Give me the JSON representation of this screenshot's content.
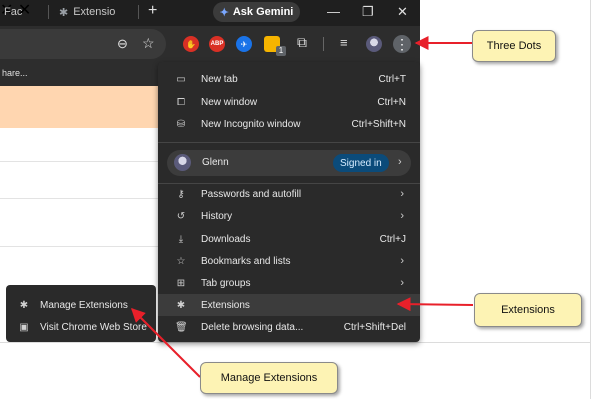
{
  "tabs": [
    {
      "title": "Fac",
      "close": "✕"
    },
    {
      "title": "Extensio",
      "close": "✕"
    }
  ],
  "new_tab": "+",
  "ask_gemini": "Ask Gemini",
  "window_controls": {
    "minimize": "—",
    "restore": "❐",
    "close": "✕"
  },
  "bookmark_bar_text": "hare...",
  "menu": {
    "items": [
      {
        "label": "New tab",
        "shortcut": "Ctrl+T",
        "icon": "new-tab-icon"
      },
      {
        "label": "New window",
        "shortcut": "Ctrl+N",
        "icon": "new-window-icon"
      },
      {
        "label": "New Incognito window",
        "shortcut": "Ctrl+Shift+N",
        "icon": "incognito-icon"
      }
    ],
    "profile": {
      "name": "Glenn",
      "status": "Signed in"
    },
    "items2": [
      {
        "label": "Passwords and autofill",
        "icon": "key-icon"
      },
      {
        "label": "History",
        "icon": "history-icon"
      },
      {
        "label": "Downloads",
        "shortcut": "Ctrl+J",
        "icon": "download-icon"
      },
      {
        "label": "Bookmarks and lists",
        "icon": "star-icon"
      },
      {
        "label": "Tab groups",
        "icon": "tab-groups-icon"
      },
      {
        "label": "Extensions",
        "icon": "puzzle-icon"
      },
      {
        "label": "Delete browsing data...",
        "shortcut": "Ctrl+Shift+Del",
        "icon": "trash-icon"
      }
    ]
  },
  "submenu": [
    {
      "label": "Manage Extensions",
      "icon": "puzzle-icon"
    },
    {
      "label": "Visit Chrome Web Store",
      "icon": "store-icon"
    }
  ],
  "callouts": {
    "three_dots": "Three Dots",
    "extensions": "Extensions",
    "manage_extensions": "Manage Extensions"
  },
  "toolbar_badge": "1",
  "colors": {
    "callout_bg": "#fdf3b4",
    "arrow": "#e8202a",
    "menu_bg": "#2a2a2a",
    "highlight": "#3c3c3c"
  }
}
